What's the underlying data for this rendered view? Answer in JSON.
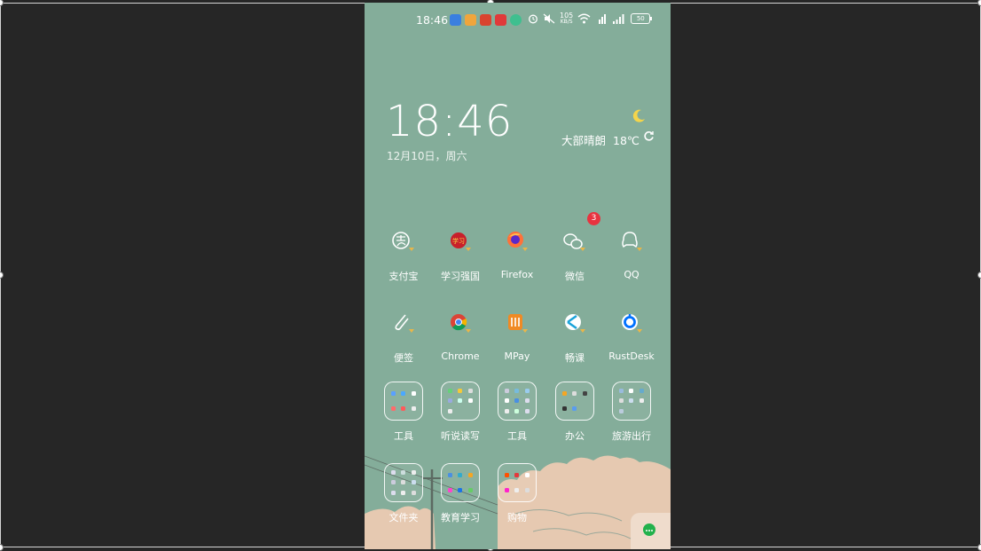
{
  "status_bar": {
    "time": "18:46",
    "net_speed_value": "105",
    "net_speed_unit": "KB/S",
    "battery": "50"
  },
  "clock": {
    "time": "18:46",
    "date": "12月10日，周六"
  },
  "weather": {
    "condition": "大部晴朗",
    "temperature": "18℃"
  },
  "apps_row1": [
    {
      "label": "支付宝",
      "icon": "alipay-icon"
    },
    {
      "label": "学习强国",
      "icon": "xuexi-qiangguo-icon"
    },
    {
      "label": "Firefox",
      "icon": "firefox-icon"
    },
    {
      "label": "微信",
      "icon": "wechat-icon",
      "badge": "3"
    },
    {
      "label": "QQ",
      "icon": "qq-icon"
    }
  ],
  "apps_row2": [
    {
      "label": "便签",
      "icon": "notes-clip-icon"
    },
    {
      "label": "Chrome",
      "icon": "chrome-icon"
    },
    {
      "label": "MPay",
      "icon": "mpay-icon"
    },
    {
      "label": "畅课",
      "icon": "changke-icon"
    },
    {
      "label": "RustDesk",
      "icon": "rustdesk-icon"
    }
  ],
  "folders_row1": [
    {
      "label": "工具"
    },
    {
      "label": "听说读写"
    },
    {
      "label": "工具"
    },
    {
      "label": "办公"
    },
    {
      "label": "旅游出行"
    }
  ],
  "folders_row2": [
    {
      "label": "文件夹"
    },
    {
      "label": "教育学习"
    },
    {
      "label": "购物"
    }
  ],
  "colors": {
    "wallpaper": "#84ad9a",
    "badge": "#e8333f",
    "moon": "#f5d54a"
  }
}
